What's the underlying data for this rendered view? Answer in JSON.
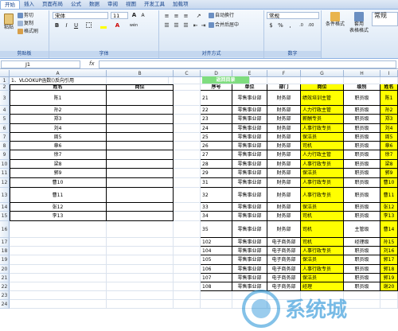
{
  "tabs": [
    "开始",
    "插入",
    "页面布局",
    "公式",
    "数据",
    "审阅",
    "视图",
    "开发工具",
    "加载项"
  ],
  "ribbon": {
    "clipboard": {
      "paste": "粘贴",
      "cut": "剪切",
      "copy": "复制",
      "format_painter": "格式刷",
      "label": "剪贴板"
    },
    "font": {
      "name": "宋体",
      "size": "11",
      "label": "字体",
      "bold": "B",
      "italic": "I",
      "underline": "U",
      "grow": "A",
      "shrink": "A",
      "wen": "wén"
    },
    "align": {
      "wrap": "自动换行",
      "merge": "合并后居中",
      "label": "对齐方式"
    },
    "number": {
      "format": "常规",
      "label": "数字"
    },
    "styles": {
      "cond": "条件格式",
      "table": "套用\n表格格式",
      "normal": "常规"
    }
  },
  "formula": {
    "cell": "J1",
    "fx": "fx",
    "value": ""
  },
  "columns": [
    "A",
    "B",
    "C",
    "D",
    "E",
    "F",
    "G",
    "H",
    "I"
  ],
  "rows": [
    "1",
    "2",
    "3",
    "4",
    "5",
    "6",
    "7",
    "8",
    "9",
    "10",
    "11",
    "12",
    "13",
    "14",
    "15",
    "16",
    "17",
    "18",
    "19",
    "20",
    "21",
    "22",
    "23",
    "24"
  ],
  "left_title": "1、VLOOKUP函数()反向引用",
  "left_headers": [
    "姓名",
    "岗位"
  ],
  "left_names": [
    "陈1",
    "孙2",
    "郑3",
    "刘4",
    "周5",
    "章6",
    "徐7",
    "梁8",
    "郭9",
    "曹10",
    "曹11",
    "张12",
    "李13"
  ],
  "back_button": "返回目录",
  "right_headers": [
    "序号",
    "单位",
    "部门",
    "岗位",
    "级别",
    "姓名"
  ],
  "right_rows": [
    [
      "21",
      "零售事业部",
      "财务部",
      "绩效培训主管",
      "职员级",
      "陈1"
    ],
    [
      "22",
      "零售事业部",
      "财务部",
      "人力行政主管",
      "职员级",
      "孙2"
    ],
    [
      "23",
      "零售事业部",
      "财务部",
      "薪酬专员",
      "职员级",
      "郑3"
    ],
    [
      "24",
      "零售事业部",
      "财务部",
      "人事行政专员",
      "职员级",
      "刘4"
    ],
    [
      "25",
      "零售事业部",
      "财务部",
      "保洁员",
      "职员级",
      "周5"
    ],
    [
      "26",
      "零售事业部",
      "财务部",
      "司机",
      "职员级",
      "章6"
    ],
    [
      "27",
      "零售事业部",
      "财务部",
      "人力行政主管",
      "职员级",
      "徐7"
    ],
    [
      "28",
      "零售事业部",
      "财务部",
      "人事行政专员",
      "职员级",
      "梁8"
    ],
    [
      "29",
      "零售事业部",
      "财务部",
      "保洁员",
      "职员级",
      "郭9"
    ],
    [
      "31",
      "零售事业部",
      "财务部",
      "人事行政专员",
      "职员级",
      "曹10"
    ],
    [
      "32",
      "零售事业部",
      "财务部",
      "人事行政专员",
      "职员级",
      "曹11"
    ],
    [
      "33",
      "零售事业部",
      "财务部",
      "保洁员",
      "职员级",
      "张12"
    ],
    [
      "34",
      "零售事业部",
      "财务部",
      "司机",
      "职员级",
      "李13"
    ],
    [
      "35",
      "零售事业部",
      "财务部",
      "司机",
      "主管级",
      "曹14"
    ],
    [
      "102",
      "零售事业部",
      "电子商务部",
      "司机",
      "经理级",
      "孙15"
    ],
    [
      "104",
      "零售事业部",
      "电子商务部",
      "人事行政专员",
      "职员级",
      "刘16"
    ],
    [
      "105",
      "零售事业部",
      "电子商务部",
      "保洁员",
      "职员级",
      "郭17"
    ],
    [
      "106",
      "零售事业部",
      "电子商务部",
      "人事行政专员",
      "职员级",
      "郭18"
    ],
    [
      "107",
      "零售事业部",
      "电子商务部",
      "保洁员",
      "职员级",
      "郭19"
    ],
    [
      "108",
      "零售事业部",
      "电子商务部",
      "经理",
      "职员级",
      "谢20"
    ]
  ],
  "watermark": "系统城"
}
